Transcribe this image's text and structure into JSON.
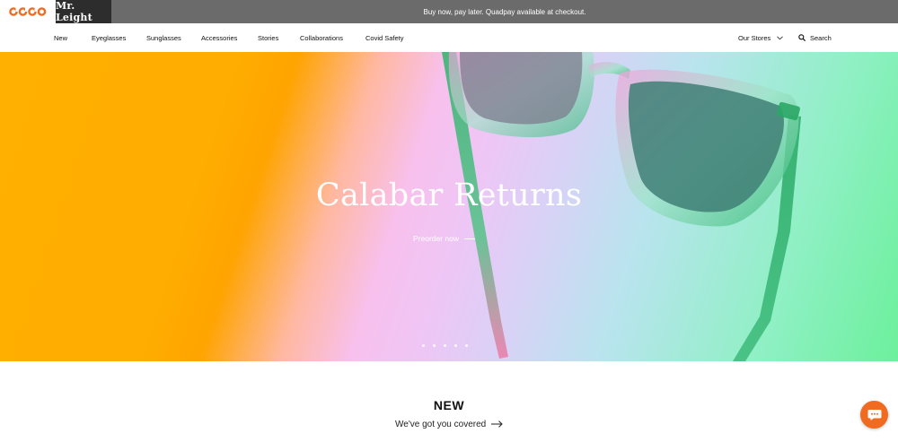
{
  "header": {
    "brand_name": "Mr. Leight",
    "promo_text": "Buy now, pay later. Quadpay available at checkout."
  },
  "nav": {
    "items": [
      {
        "label": "New"
      },
      {
        "label": "Eyeglasses"
      },
      {
        "label": "Sunglasses"
      },
      {
        "label": "Accessories"
      },
      {
        "label": "Stories"
      },
      {
        "label": "Collaborations"
      },
      {
        "label": "Covid Safety"
      }
    ],
    "stores_label": "Our Stores",
    "search_label": "Search"
  },
  "hero": {
    "title": "Calabar Returns",
    "cta_label": "Preorder now",
    "slide_count": 5,
    "active_slide": 1
  },
  "new_section": {
    "heading": "NEW",
    "subheading": "We've got you covered"
  },
  "icons": {
    "logo": "oliver-peoples-logo-icon",
    "stores_chevron": "chevron-down-icon",
    "search": "search-icon",
    "cta_arrow": "arrow-right-icon",
    "chat": "chat-icon"
  },
  "colors": {
    "topbar": "#6b6b6b",
    "brand_bg": "#2d2d2d",
    "accent": "#f06a1f"
  }
}
